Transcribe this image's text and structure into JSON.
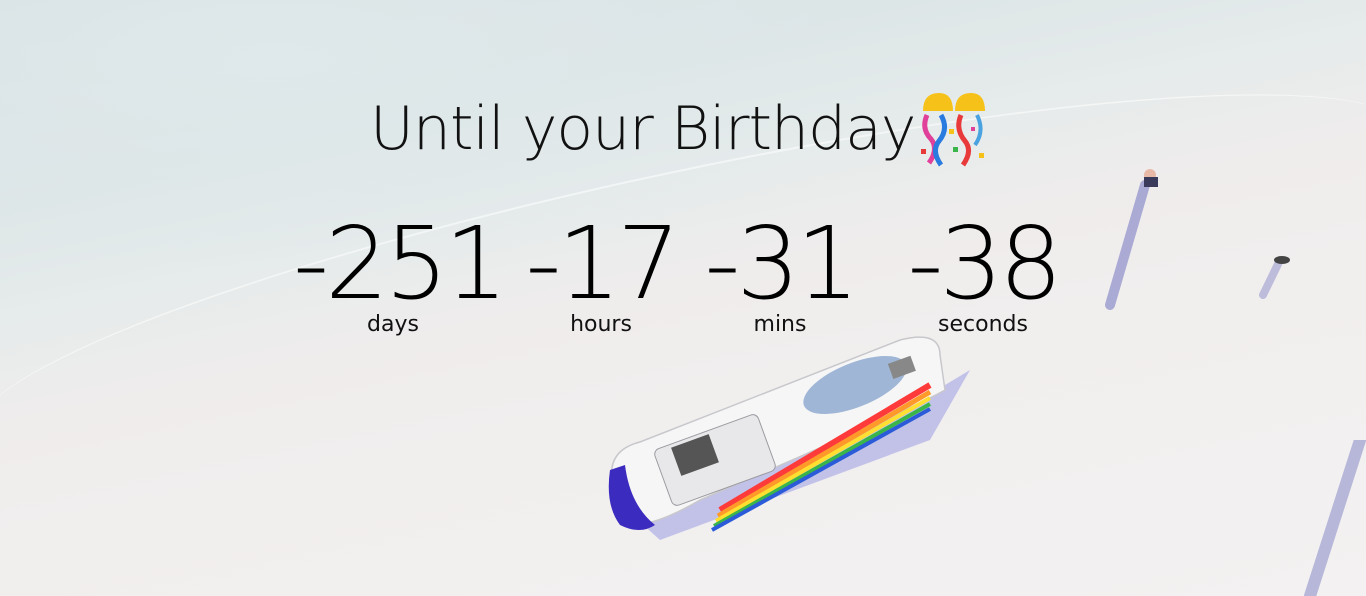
{
  "title": "Until your Birthday",
  "icons": {
    "title_emoji": "confetti-ball-icon"
  },
  "countdown": [
    {
      "value": "-251",
      "label": "days"
    },
    {
      "value": "-17",
      "label": "hours"
    },
    {
      "value": "-31",
      "label": "mins"
    },
    {
      "value": "-38",
      "label": "seconds"
    }
  ]
}
